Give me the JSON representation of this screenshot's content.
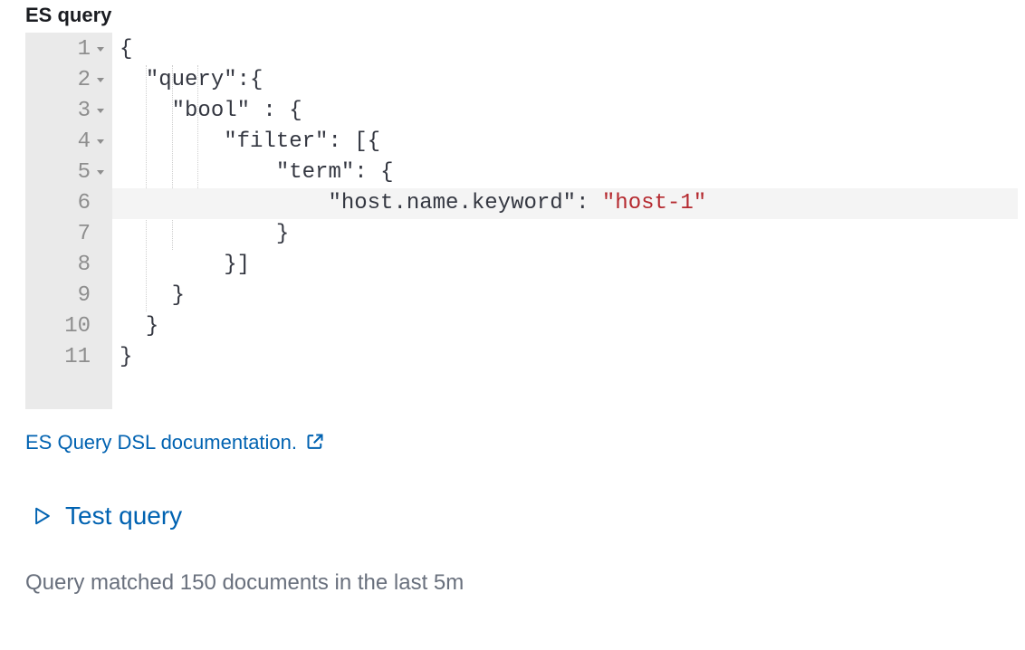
{
  "section_label": "ES query",
  "editor": {
    "highlighted_line_index": 5,
    "lines": [
      {
        "ln": 1,
        "foldable": true,
        "indent": 0,
        "tokens": [
          {
            "t": "{",
            "c": "punc"
          }
        ]
      },
      {
        "ln": 2,
        "foldable": true,
        "indent": 1,
        "tokens": [
          {
            "t": "\"query\"",
            "c": "key"
          },
          {
            "t": ":",
            "c": "punc"
          },
          {
            "t": "{",
            "c": "punc"
          }
        ]
      },
      {
        "ln": 3,
        "foldable": true,
        "indent": 2,
        "tokens": [
          {
            "t": "\"bool\"",
            "c": "key"
          },
          {
            "t": " : ",
            "c": "punc"
          },
          {
            "t": "{",
            "c": "punc"
          }
        ]
      },
      {
        "ln": 4,
        "foldable": true,
        "indent": 4,
        "tokens": [
          {
            "t": "\"filter\"",
            "c": "key"
          },
          {
            "t": ": ",
            "c": "punc"
          },
          {
            "t": "[{",
            "c": "punc"
          }
        ]
      },
      {
        "ln": 5,
        "foldable": true,
        "indent": 6,
        "tokens": [
          {
            "t": "\"term\"",
            "c": "key"
          },
          {
            "t": ": ",
            "c": "punc"
          },
          {
            "t": "{",
            "c": "punc"
          }
        ]
      },
      {
        "ln": 6,
        "foldable": false,
        "indent": 8,
        "tokens": [
          {
            "t": "\"host.name.keyword\"",
            "c": "key"
          },
          {
            "t": ": ",
            "c": "punc"
          },
          {
            "t": "\"host-1\"",
            "c": "str"
          }
        ]
      },
      {
        "ln": 7,
        "foldable": false,
        "indent": 6,
        "tokens": [
          {
            "t": "}",
            "c": "punc"
          }
        ]
      },
      {
        "ln": 8,
        "foldable": false,
        "indent": 4,
        "tokens": [
          {
            "t": "}]",
            "c": "punc"
          }
        ]
      },
      {
        "ln": 9,
        "foldable": false,
        "indent": 2,
        "tokens": [
          {
            "t": "}",
            "c": "punc"
          }
        ]
      },
      {
        "ln": 10,
        "foldable": false,
        "indent": 1,
        "tokens": [
          {
            "t": "}",
            "c": "punc"
          }
        ]
      },
      {
        "ln": 11,
        "foldable": false,
        "indent": 0,
        "tokens": [
          {
            "t": "}",
            "c": "punc"
          }
        ]
      }
    ]
  },
  "doc_link_text": "ES Query DSL documentation.",
  "test_query_label": "Test query",
  "status_text": "Query matched 150 documents in the last 5m"
}
